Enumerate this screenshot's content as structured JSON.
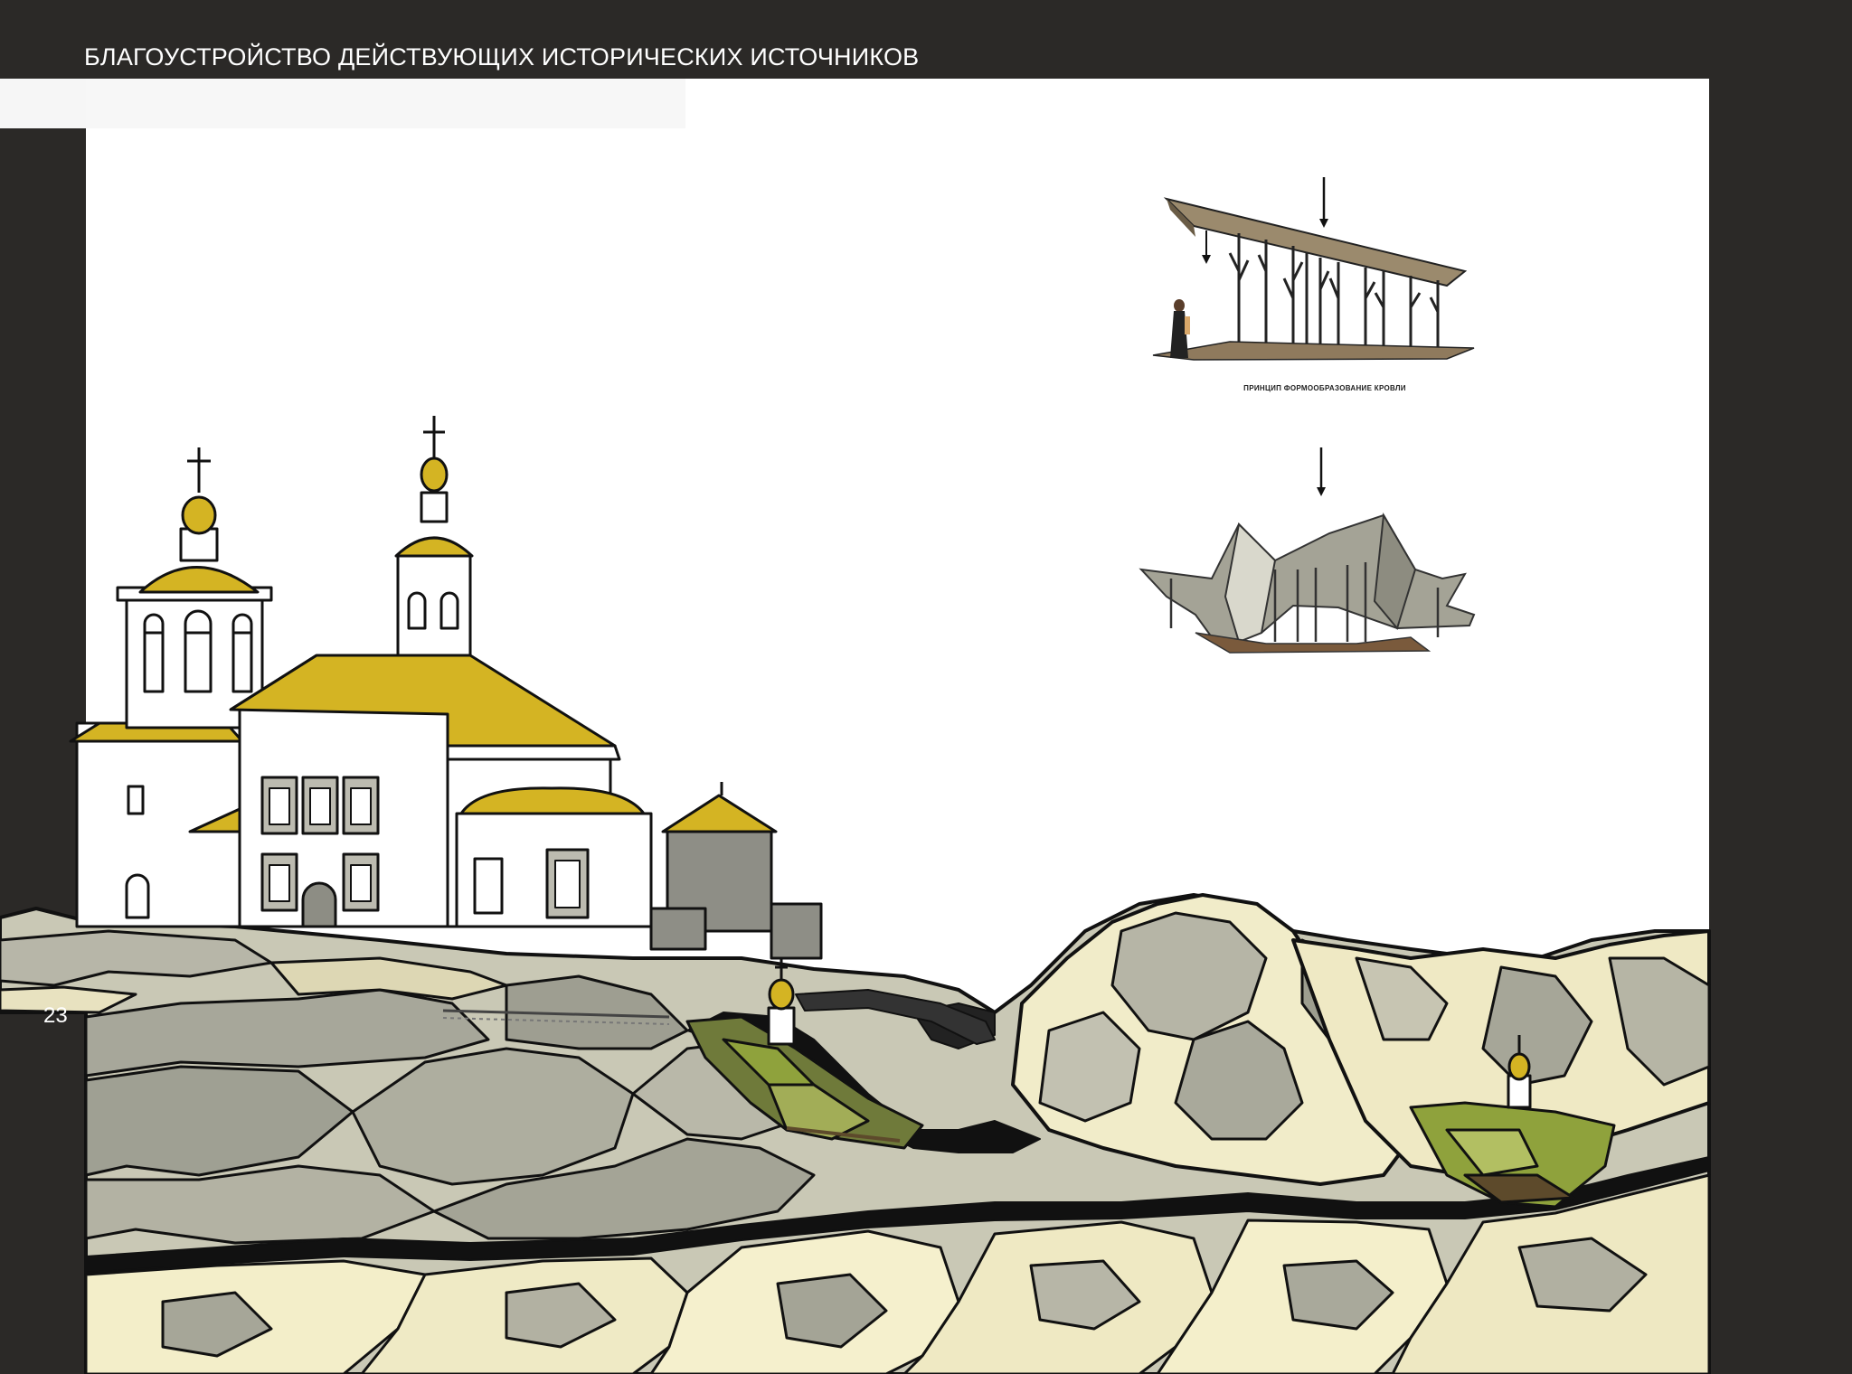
{
  "header": {
    "title": "БЛАГОУСТРОЙСТВО ДЕЙСТВУЮЩИХ ИСТОРИЧЕСКИХ ИСТОЧНИКОВ"
  },
  "page": {
    "number": "23"
  },
  "diagram": {
    "caption": "ПРИНЦИП ФОРМООБРАЗОВАНИЕ КРОВЛИ"
  },
  "colors": {
    "frame": "#2b2927",
    "gold": "#d4b423",
    "sand": "#f4efcc",
    "stone": "#a3a39a",
    "olive": "#7f8a64",
    "pavilion_green": "#8fa23c",
    "wood": "#7a5a3c"
  }
}
